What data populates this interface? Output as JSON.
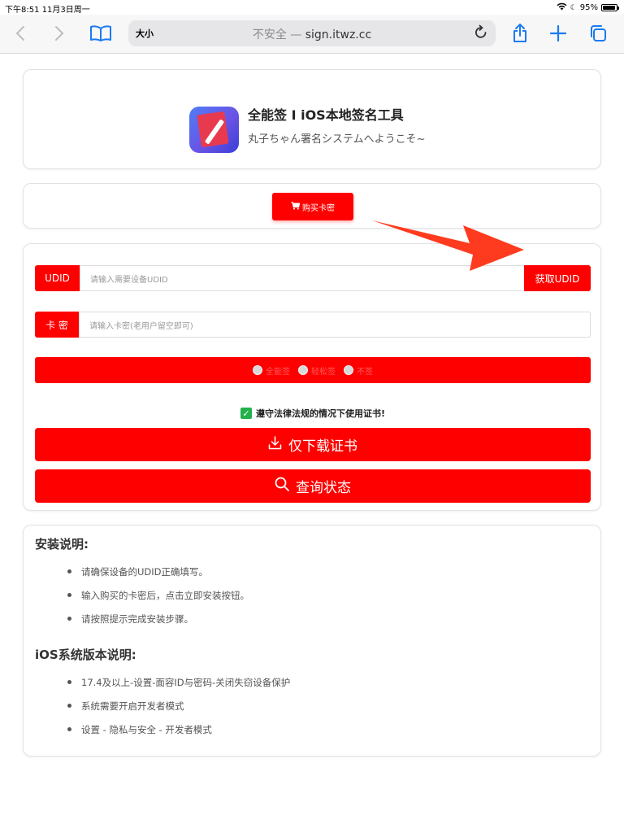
{
  "status_bar": {
    "time_date": "下午8:51  11月3日周一",
    "battery": "95%",
    "battery_level": 0.95
  },
  "browser": {
    "text_size": "大小",
    "insecure_label": "不安全 —",
    "domain": "sign.itwz.cc"
  },
  "header": {
    "title": "全能签 I iOS本地签名工具",
    "subtitle": "丸子ちゃん署名システムへようこそ~"
  },
  "buy": {
    "label": "购买卡密"
  },
  "form": {
    "udid_label": "UDID",
    "udid_placeholder": "请输入需要设备UDID",
    "get_udid_label": "获取UDID",
    "card_label": "卡 密",
    "card_placeholder": "请输入卡密(老用户留空即可)",
    "options": [
      "全能签",
      "轻松签",
      "不签"
    ],
    "agree_text": "遵守法律法规的情况下使用证书!",
    "download_label": "仅下载证书",
    "query_label": "查询状态"
  },
  "info": {
    "install_heading": "安装说明:",
    "install_items": [
      "请确保设备的UDID正确填写。",
      "输入购买的卡密后，点击立即安装按钮。",
      "请按照提示完成安装步骤。"
    ],
    "ios_heading": "iOS系统版本说明:",
    "ios_items": [
      "17.4及以上-设置-面容ID与密码-关闭失窃设备保护",
      "系统需要开启开发者模式",
      "设置 - 隐私与安全 - 开发者模式"
    ]
  },
  "colors": {
    "accent_red": "#ff0000",
    "safari_blue": "#1a7bf2",
    "check_green": "#24b04a",
    "arrow_red": "#ff3b1f"
  }
}
